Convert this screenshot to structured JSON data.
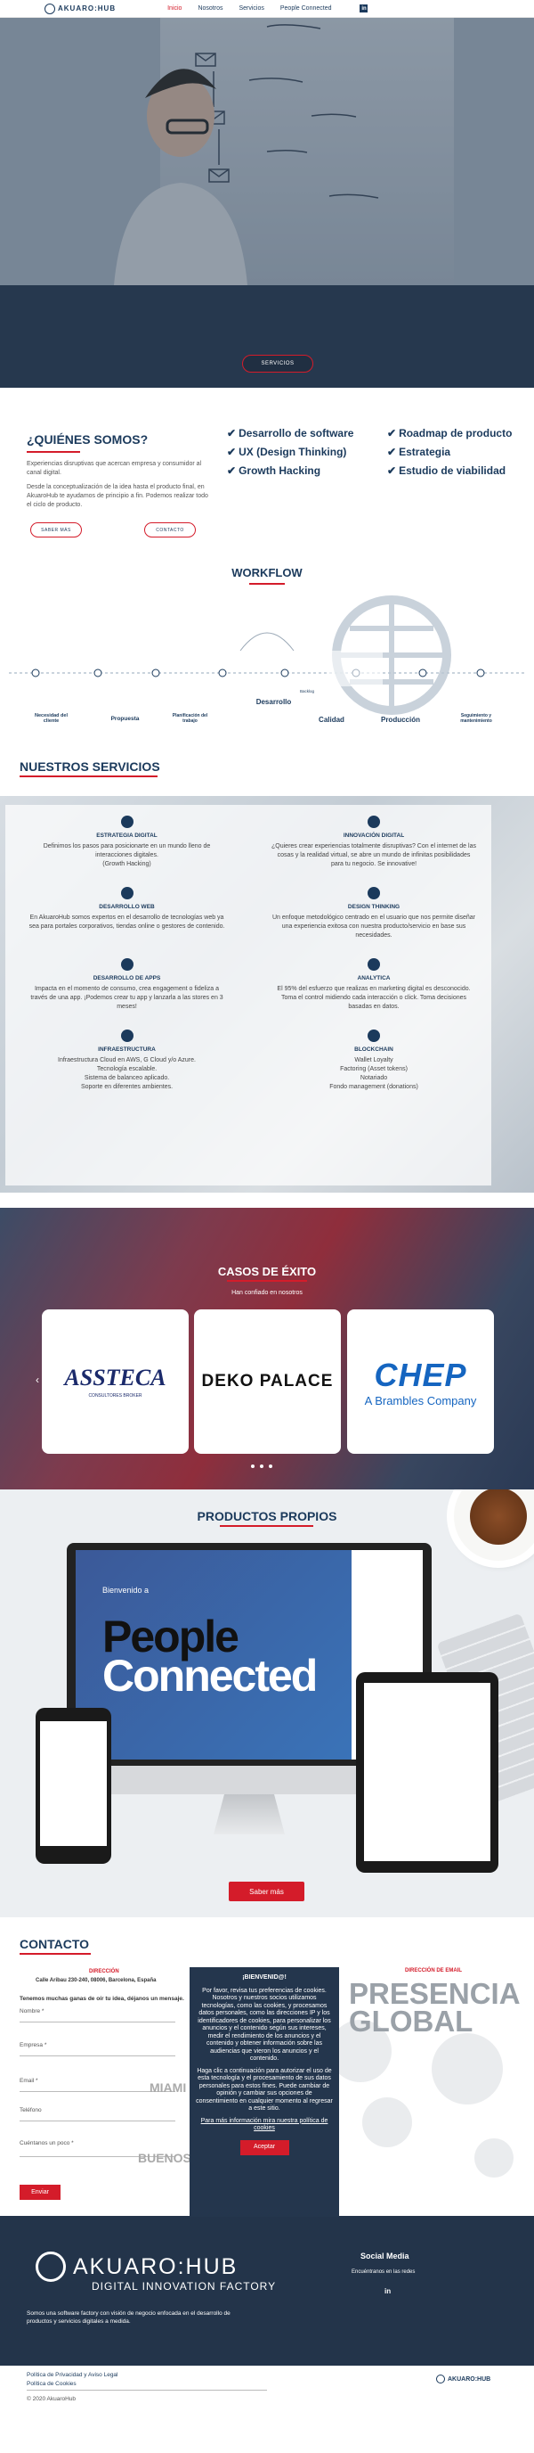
{
  "header": {
    "logo": "AKUARO:HUB",
    "nav": [
      "Inicio",
      "Nosotros",
      "Servicios",
      "People Connected"
    ],
    "linkedin": "in"
  },
  "hero": {
    "button": "SERVICIOS"
  },
  "quienes": {
    "title": "¿QUIÉNES SOMOS?",
    "p1": "Experiencias disruptivas que acercan empresa y consumidor al canal digital.",
    "p2": "Desde la conceptualización de la idea hasta el producto final, en AkuaroHub te ayudamos de principio a fin. Podemos realizar todo el ciclo de producto.",
    "btn_more": "SABER MÁS",
    "btn_contact": "CONTACTO",
    "checks": [
      "Desarrollo de software",
      "Roadmap de producto",
      "UX (Design Thinking)",
      "Estrategia",
      "Growth Hacking",
      "Estudio de viabilidad"
    ]
  },
  "workflow": {
    "title": "WORKFLOW",
    "steps": [
      "Necesidad del cliente",
      "Propuesta",
      "Planificación del trabajo",
      "Desarrollo",
      "Calidad",
      "Producción",
      "Seguimiento y mantenimiento"
    ],
    "extra": "Backlog"
  },
  "servicios": {
    "title": "NUESTROS SERVICIOS",
    "items": [
      {
        "title": "ESTRATEGIA DIGITAL",
        "text": "Definimos los pasos para posicionarte en un mundo lleno de interacciones digitales.",
        "extra": "(Growth Hacking)"
      },
      {
        "title": "INNOVACIÓN DIGITAL",
        "text": "¿Quieres crear experiencias totalmente disruptivas? Con el internet de las cosas y la realidad virtual, se abre un mundo de infinitas posibilidades para tu negocio. Se innovative!",
        "extra": ""
      },
      {
        "title": "DESARROLLO WEB",
        "text": "En AkuaroHub somos expertos en el desarrollo de tecnologías web ya sea para portales corporativos, tiendas online o gestores de contenido.",
        "extra": ""
      },
      {
        "title": "DESIGN THINKING",
        "text": "Un enfoque metodológico centrado en el usuario que nos permite diseñar una experiencia exitosa con nuestra producto/servicio en base sus necesidades.",
        "extra": ""
      },
      {
        "title": "DESARROLLO DE APPS",
        "text": "Impacta en el momento de consumo, crea engagement o fideliza a través de una app. ¡Podemos crear tu app y lanzarla a las stores en 3 meses!",
        "extra": ""
      },
      {
        "title": "ANALYTICA",
        "text": "El 95% del esfuerzo que realizas en marketing digital es desconocido. Toma el control midiendo cada interacción o click. Toma decisiones basadas en datos.",
        "extra": ""
      },
      {
        "title": "INFRAESTRUCTURA",
        "text": "Infraestructura Cloud en AWS, G Cloud y/o Azure.",
        "lines": [
          "Tecnología escalable.",
          "Sistema de balanceo aplicado.",
          "Soporte en diferentes ambientes."
        ]
      },
      {
        "title": "BLOCKCHAIN",
        "text": "Wallet Loyalty",
        "lines": [
          "Factoring (Asset tokens)",
          "Notariado",
          "Fondo management (donations)"
        ]
      }
    ]
  },
  "casos": {
    "title": "CASOS DE ÉXITO",
    "subtitle": "Han confiado en nosotros",
    "logos": [
      {
        "name": "ASSTECA",
        "sub": "CONSULTORES BROKER"
      },
      {
        "name": "DEKO PALACE",
        "sub": ""
      },
      {
        "name": "CHEP",
        "sub": "A Brambles Company"
      }
    ]
  },
  "productos": {
    "title": "PRODUCTOS PROPIOS",
    "welcome": "Bienvenido a",
    "logo_l1": "People",
    "logo_l2": "Connected",
    "button": "Saber más"
  },
  "contacto": {
    "title": "CONTACTO",
    "dir_title": "DIRECCIÓN",
    "address": "Calle Aribau 230-240, 08006, Barcelona, España",
    "lead": "Tenemos muchas ganas de oír tu idea, déjanos un mensaje.",
    "fields": [
      "Nombre *",
      "Empresa *",
      "Email *",
      "Teléfono",
      "Cuéntanos un poco *"
    ],
    "send": "Enviar",
    "email_title": "DIRECCIÓN DE EMAIL",
    "presence": [
      "PRESENCIA",
      "GLOBAL"
    ],
    "cities": [
      "MIAMI",
      "BUENOS AIRES"
    ]
  },
  "cookie": {
    "title": "¡BIENVENID@!",
    "p1": "Por favor, revisa tus preferencias de cookies. Nosotros y nuestros socios utilizamos tecnologías, como las cookies, y procesamos datos personales, como las direcciones IP y los identificadores de cookies, para personalizar los anuncios y el contenido según sus intereses, medir el rendimiento de los anuncios y el contenido y obtener información sobre las audiencias que vieron los anuncios y el contenido.",
    "p2": "Haga clic a continuación para autorizar el uso de esta tecnología y el procesamiento de sus datos personales para estos fines. Puede cambiar de opinión y cambiar sus opciones de consentimiento en cualquier momento al regresar a este sitio.",
    "more": "Para más información mira nuestra política de cookies",
    "accept": "Aceptar"
  },
  "footer": {
    "brand": "AKUARO:HUB",
    "tagline": "DIGITAL INNOVATION FACTORY",
    "description": "Somos una software factory con visión de negocio enfocada en el desarrollo de productos y servicios digitales a medida.",
    "social_title": "Social Media",
    "social_sub": "Encuéntranos en las redes",
    "linkedin": "in"
  },
  "bottom": {
    "privacy": "Política de Privacidad y Aviso Legal",
    "cookies": "Política de Cookies",
    "copyright": "© 2020 AkuaroHub",
    "mini_logo": "AKUARO:HUB"
  }
}
